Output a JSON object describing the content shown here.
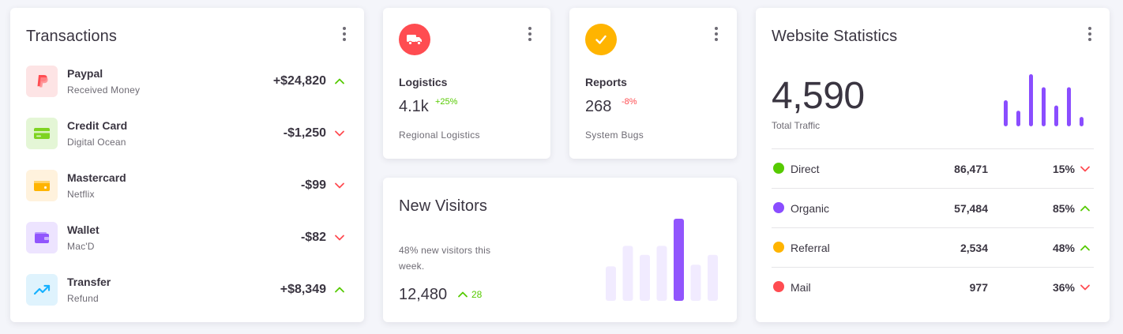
{
  "transactions": {
    "title": "Transactions",
    "items": [
      {
        "name": "Paypal",
        "sub": "Received Money",
        "amount": "+$24,820",
        "trend": "up",
        "icon": "paypal-icon"
      },
      {
        "name": "Credit Card",
        "sub": "Digital Ocean",
        "amount": "-$1,250",
        "trend": "down",
        "icon": "credit-card-icon"
      },
      {
        "name": "Mastercard",
        "sub": "Netflix",
        "amount": "-$99",
        "trend": "down",
        "icon": "mastercard-icon"
      },
      {
        "name": "Wallet",
        "sub": "Mac'D",
        "amount": "-$82",
        "trend": "down",
        "icon": "wallet-icon"
      },
      {
        "name": "Transfer",
        "sub": "Refund",
        "amount": "+$8,349",
        "trend": "up",
        "icon": "trending-up-icon"
      }
    ]
  },
  "logistics": {
    "title": "Logistics",
    "value": "4.1k",
    "change": "+25%",
    "sub": "Regional Logistics",
    "icon": "truck-icon"
  },
  "reports": {
    "title": "Reports",
    "value": "268",
    "change": "-8%",
    "sub": "System Bugs",
    "icon": "check-icon"
  },
  "visitors": {
    "title": "New Visitors",
    "text": "48% new visitors this week.",
    "value": "12,480",
    "change": "28",
    "bar_levels": [
      0.42,
      0.67,
      0.56,
      0.67,
      1.0,
      0.44,
      0.56
    ],
    "highlight_index": 4
  },
  "website": {
    "title": "Website Statistics",
    "value": "4,590",
    "sub": "Total Traffic",
    "bar_levels": [
      0.5,
      0.3,
      1.0,
      0.75,
      0.4,
      0.75,
      0.18
    ],
    "sources": [
      {
        "name": "Direct",
        "count": "86,471",
        "pct": "15%",
        "trend": "down",
        "color": "#56ca00"
      },
      {
        "name": "Organic",
        "count": "57,484",
        "pct": "85%",
        "trend": "up",
        "color": "#8a4dff"
      },
      {
        "name": "Referral",
        "count": "2,534",
        "pct": "48%",
        "trend": "up",
        "color": "#ffb400"
      },
      {
        "name": "Mail",
        "count": "977",
        "pct": "36%",
        "trend": "down",
        "color": "#ff4c51"
      }
    ]
  },
  "colors": {
    "up": "#56ca00",
    "down": "#ff4c51",
    "primary": "#9155fd",
    "primary_light": "#f1ebff",
    "warning": "#ffb400",
    "error": "#ff4c51"
  }
}
